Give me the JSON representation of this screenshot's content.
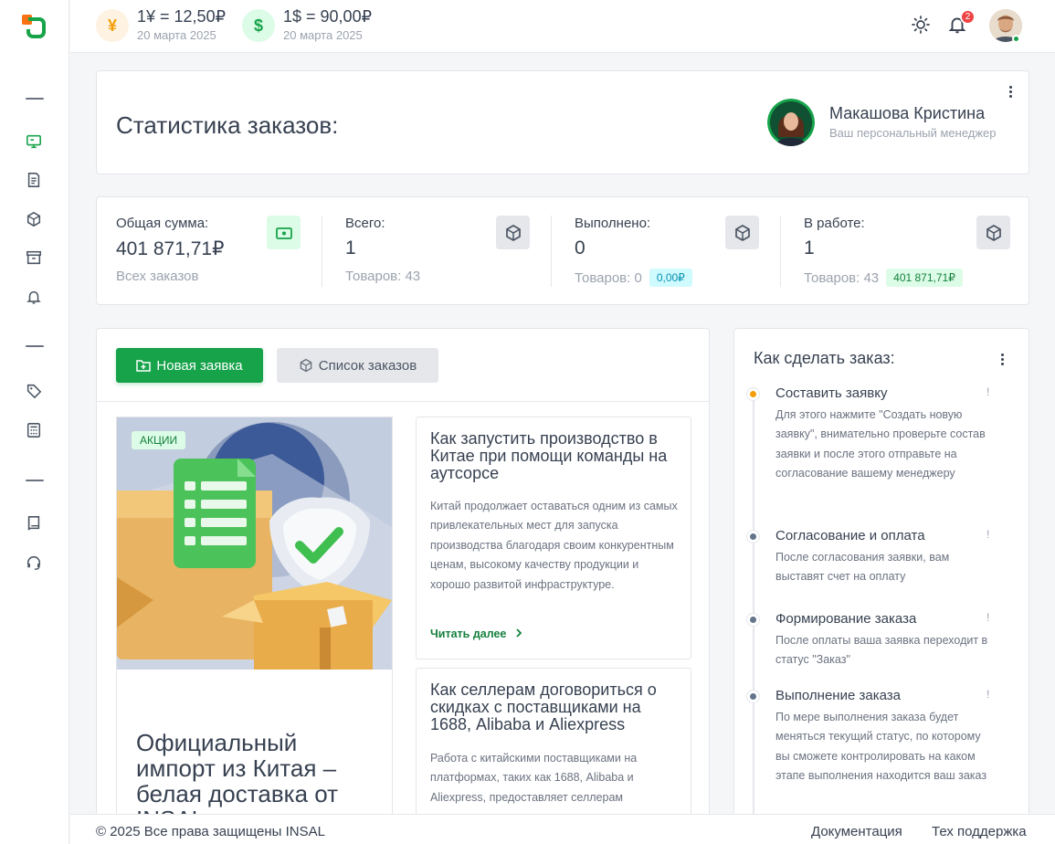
{
  "rates": [
    {
      "symbol": "¥",
      "value": "1¥ = 12,50₽",
      "date": "20 марта 2025",
      "color": "#f59e0b",
      "bg": "#fef3e2"
    },
    {
      "symbol": "$",
      "value": "1$ = 90,00₽",
      "date": "20 марта 2025",
      "color": "#16a34a",
      "bg": "#dcfce7"
    }
  ],
  "header": {
    "notification_count": "2"
  },
  "stats_card": {
    "title": "Статистика заказов:",
    "manager_name": "Макашова Кристина",
    "manager_role": "Ваш персональный менеджер"
  },
  "stats": [
    {
      "label": "Общая сумма:",
      "value": "401 871,71₽",
      "sub": "Всех заказов",
      "pill": "",
      "icon": "money-icon"
    },
    {
      "label": "Всего:",
      "value": "1",
      "sub": "Товаров: 43",
      "pill": "",
      "icon": "box-icon"
    },
    {
      "label": "Выполнено:",
      "value": "0",
      "sub": "Товаров: 0",
      "pill": "0,00₽",
      "icon": "box-icon"
    },
    {
      "label": "В работе:",
      "value": "1",
      "sub": "Товаров: 43",
      "pill": "401 871,71₽",
      "icon": "box-icon"
    }
  ],
  "actions": {
    "new_request": "Новая заявка",
    "orders_list": "Список заказов"
  },
  "promo": {
    "tag": "АКЦИИ",
    "title": "Официальный импорт из Китая – белая доставка от INSAL"
  },
  "articles": [
    {
      "title": "Как запустить производство в Китае при помощи команды на аутсорсе",
      "text": "Китай продолжает оставаться одним из самых привлекательных мест для запуска производства благодаря своим конкурентным ценам, высокому качеству продукции и хорошо развитой инфраструктуре.",
      "read_more": "Читать далее"
    },
    {
      "title": "Как селлерам договориться о скидках с поставщиками на 1688, Alibaba и Aliexpress",
      "text": "Работа с китайскими поставщиками на платформах, таких как 1688, Alibaba и Aliexpress, предоставляет селлерам"
    }
  ],
  "how_to": {
    "title": "Как сделать заказ:",
    "steps": [
      {
        "title": "Составить заявку",
        "text": "Для этого нажмите \"Создать новую заявку\", внимательно проверьте состав заявки и после этого отправьте на согласование вашему менеджеру",
        "color": "#f59e0b"
      },
      {
        "title": "Согласование и оплата",
        "text": "После согласования заявки, вам выставят счет на оплату",
        "color": "#64748b"
      },
      {
        "title": "Формирование заказа",
        "text": "После оплаты ваша заявка переходит в статус \"Заказ\"",
        "color": "#64748b"
      },
      {
        "title": "Выполнение заказа",
        "text": "По мере выполнения заказа будет меняться текущий статус, по которому вы сможете контролировать на каком этапе выполнения находится ваш заказ",
        "color": "#64748b"
      }
    ]
  },
  "footer": {
    "copyright": "© 2025 Все права защищены INSAL",
    "docs": "Документация",
    "support": "Тех поддержка"
  }
}
